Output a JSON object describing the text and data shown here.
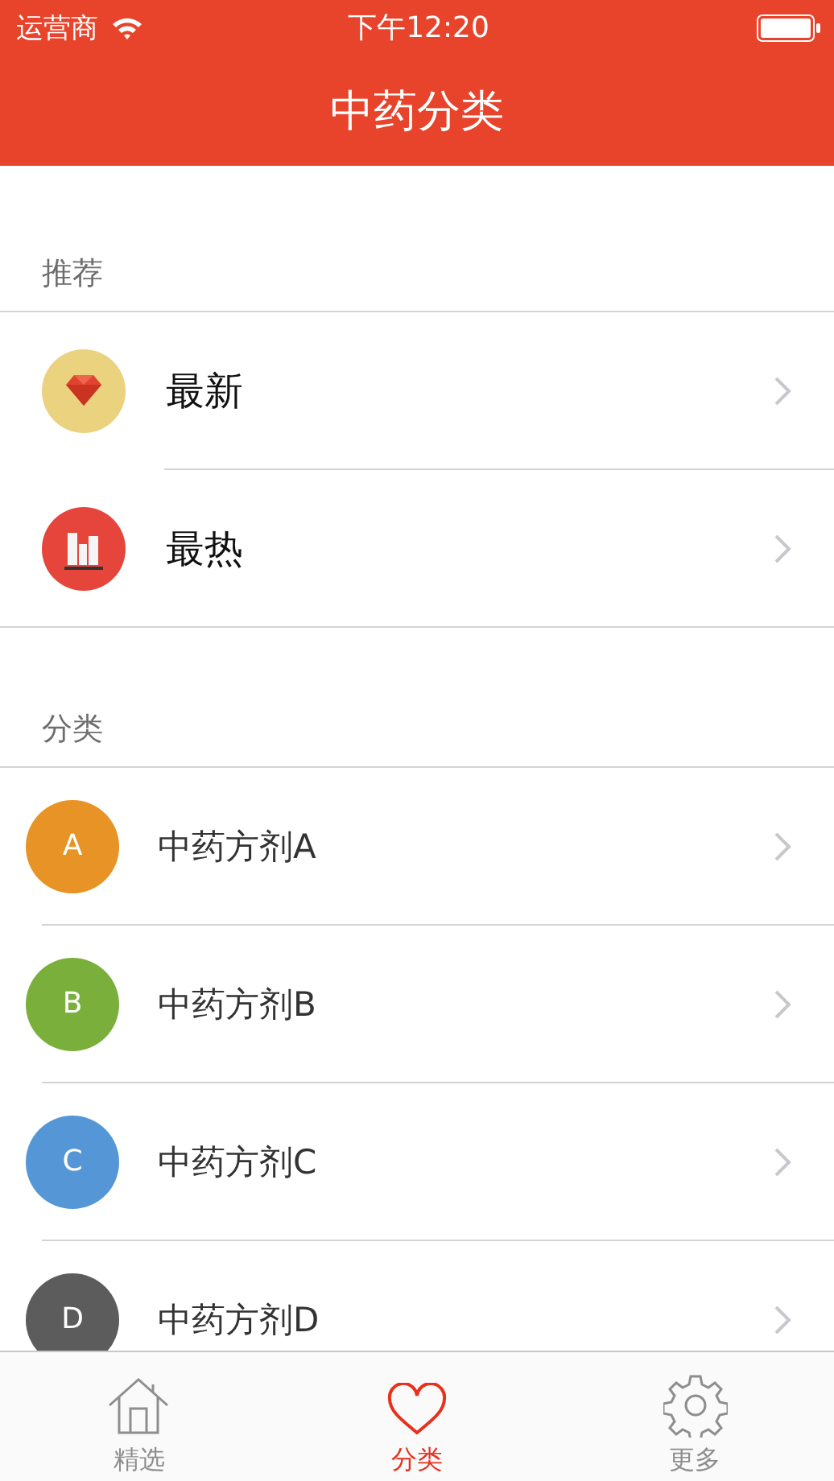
{
  "status_bar": {
    "carrier": "运营商",
    "time": "下午12:20"
  },
  "nav": {
    "title": "中药分类"
  },
  "sections": [
    {
      "header": "推荐",
      "kind": "featured",
      "items": [
        {
          "label": "最新",
          "kind": "diamond"
        },
        {
          "label": "最热",
          "kind": "chart"
        }
      ]
    },
    {
      "header": "分类",
      "kind": "category",
      "items": [
        {
          "label": "中药方剂A",
          "letter": "A",
          "color": "#e89325"
        },
        {
          "label": "中药方剂B",
          "letter": "B",
          "color": "#7aaf3b"
        },
        {
          "label": "中药方剂C",
          "letter": "C",
          "color": "#5597d6"
        },
        {
          "label": "中药方剂D",
          "letter": "D",
          "color": "#5c5c5c"
        }
      ]
    }
  ],
  "tab_bar": [
    {
      "label": "精选",
      "kind": "home",
      "selected": false
    },
    {
      "label": "分类",
      "kind": "heart",
      "selected": true
    },
    {
      "label": "更多",
      "kind": "gear",
      "selected": false
    }
  ]
}
